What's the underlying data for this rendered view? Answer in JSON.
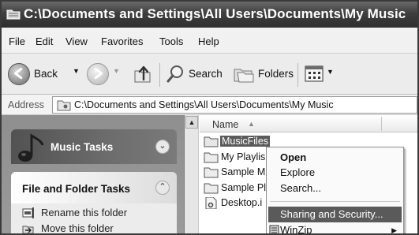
{
  "window": {
    "title": "C:\\Documents and Settings\\All Users\\Documents\\My Music"
  },
  "menubar": {
    "items": [
      "File",
      "Edit",
      "View",
      "Favorites",
      "Tools",
      "Help"
    ]
  },
  "toolbar": {
    "back_label": "Back",
    "search_label": "Search",
    "folders_label": "Folders"
  },
  "address": {
    "label": "Address",
    "value": "C:\\Documents and Settings\\All Users\\Documents\\My Music"
  },
  "taskpane": {
    "music_tasks_title": "Music Tasks",
    "file_folder_tasks_title": "File and Folder Tasks",
    "tasks": [
      "Rename this folder",
      "Move this folder"
    ]
  },
  "filelist": {
    "column_name": "Name",
    "items": [
      "MusicFiles",
      "My Playlis",
      "Sample M",
      "Sample Pl",
      "Desktop.i"
    ],
    "selected_item": "MusicFiles"
  },
  "context_menu": {
    "items": [
      "Open",
      "Explore",
      "Search...",
      "Sharing and Security...",
      "WinZip"
    ],
    "highlighted": "Sharing and Security..."
  },
  "icons": {
    "title_folder": "folder-icon",
    "back": "back-arrow-icon",
    "forward": "forward-arrow-icon",
    "up": "up-folder-icon",
    "search": "magnifier-icon",
    "folders": "folders-icon",
    "views": "views-grid-icon",
    "music_note": "music-note-icon",
    "rename": "rename-icon",
    "move": "move-icon",
    "winzip": "winzip-icon"
  }
}
